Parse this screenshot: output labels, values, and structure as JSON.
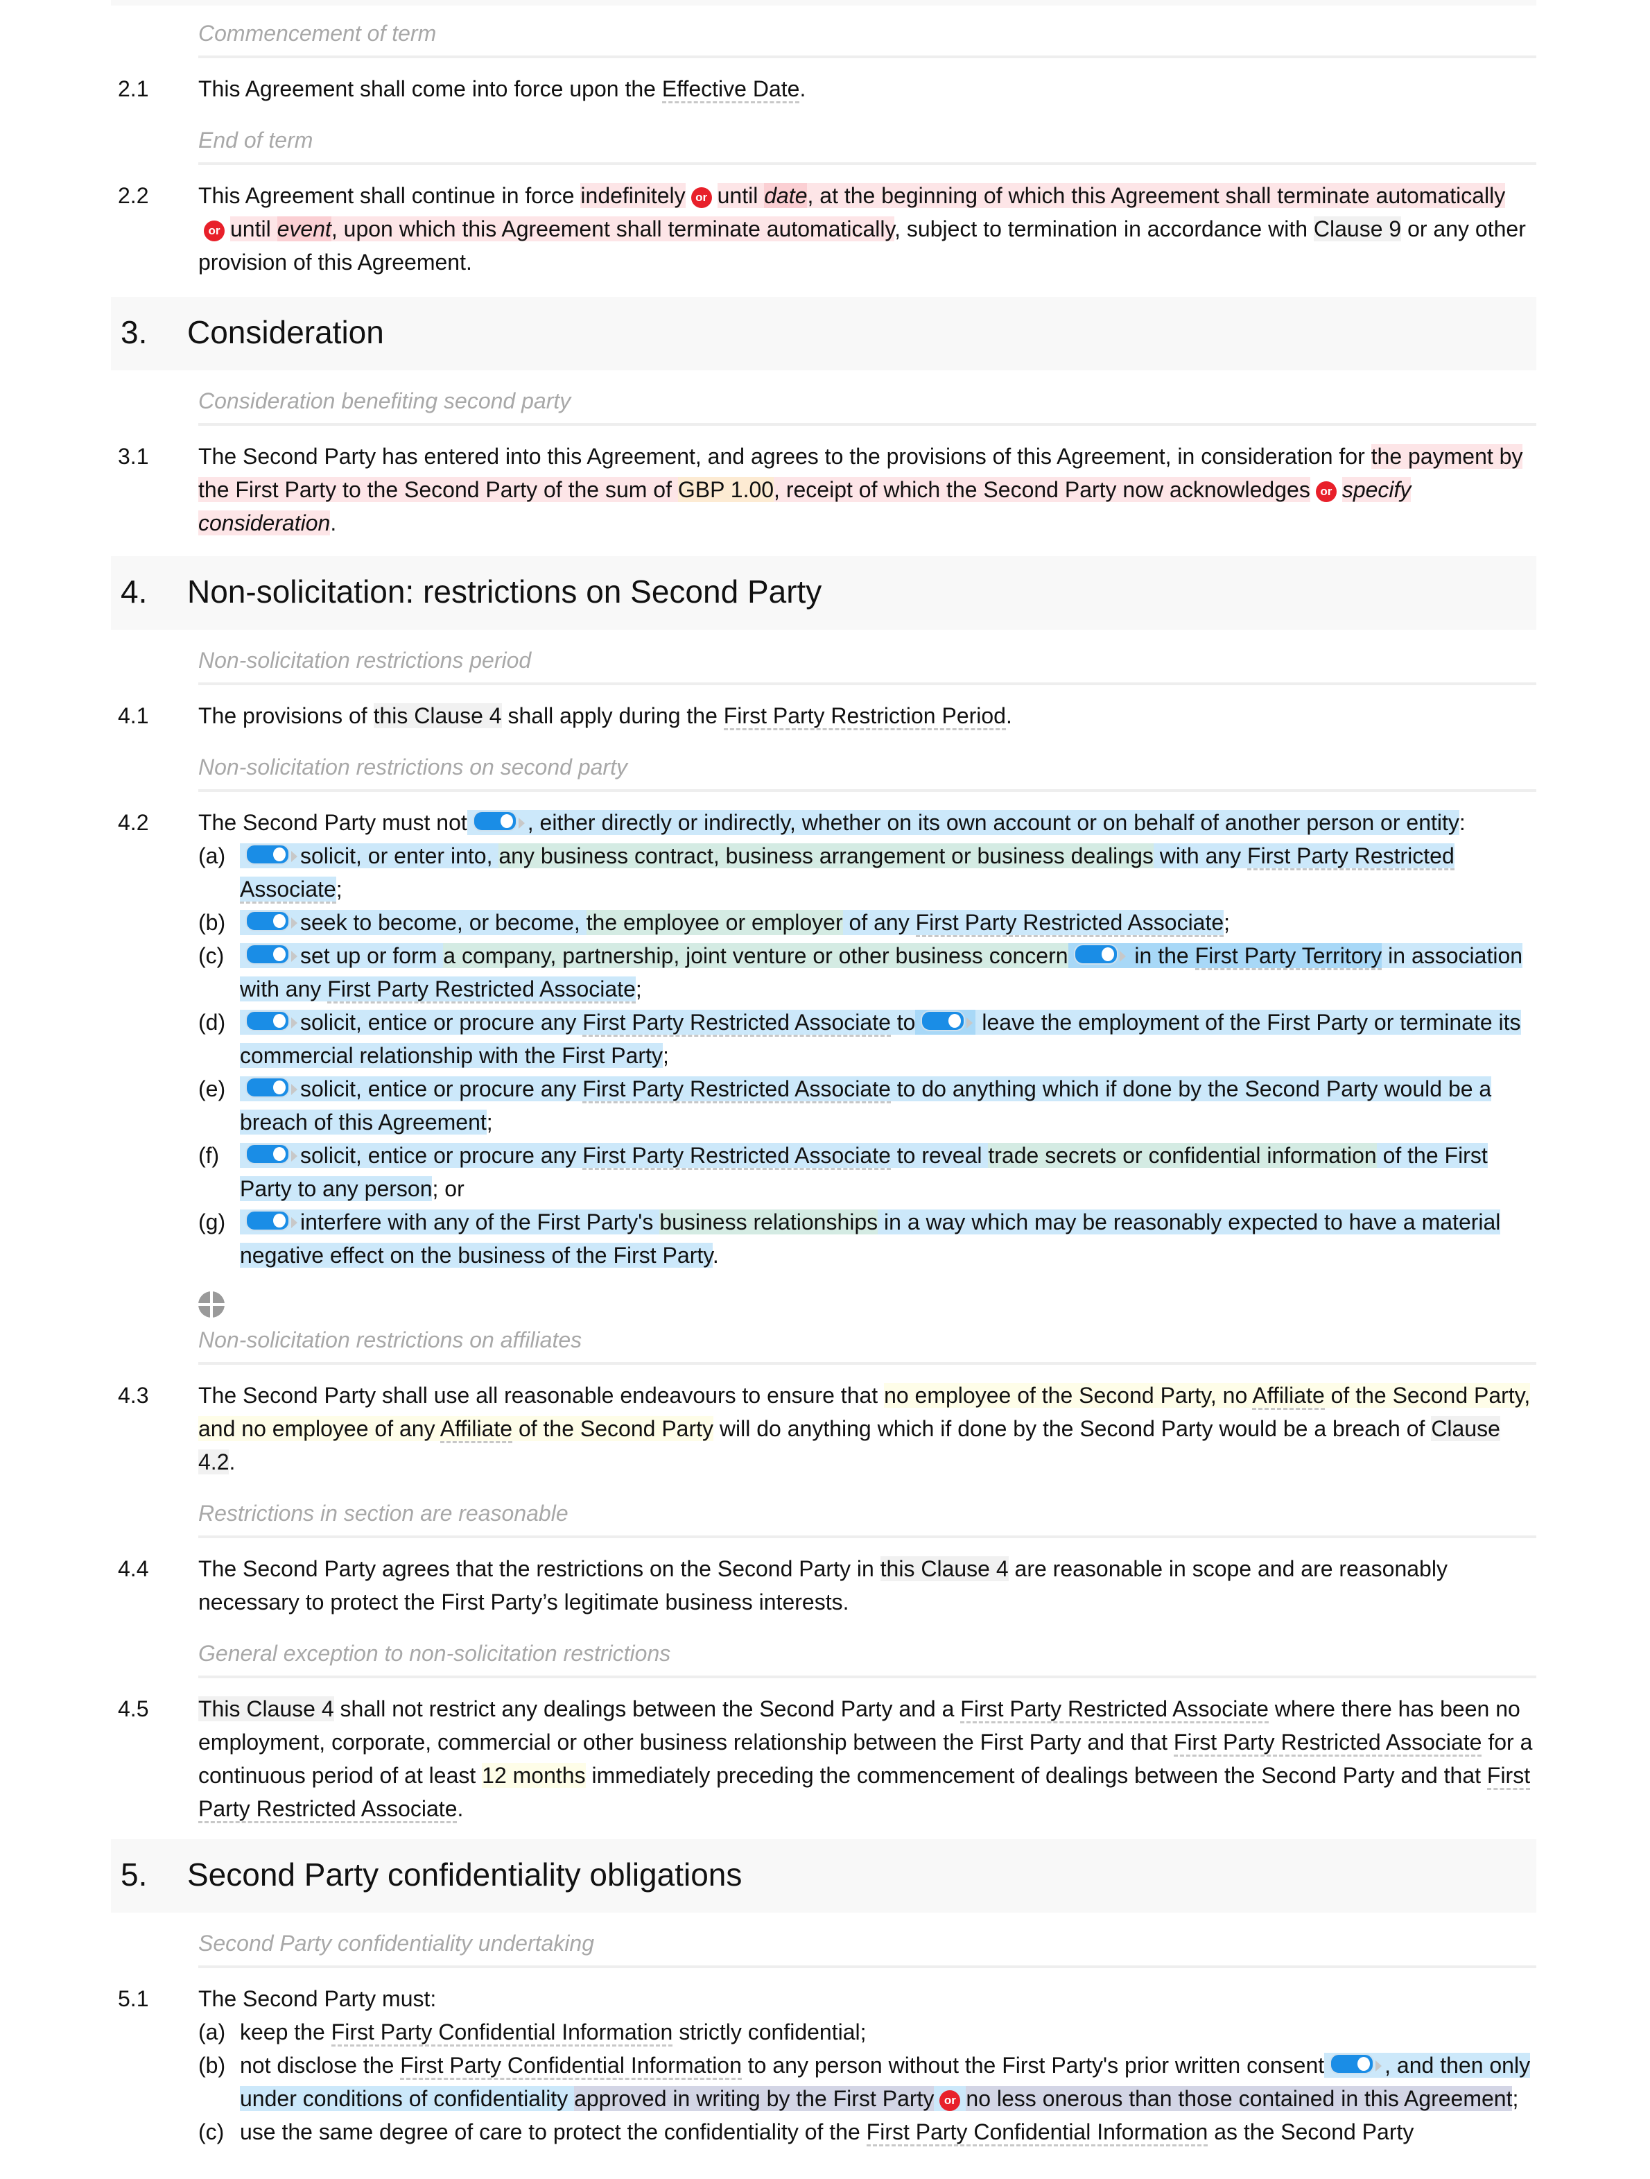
{
  "colors": {
    "or_badge": "#e8202a",
    "toggle": "#1a8de6",
    "subheading": "#a8a8a8"
  },
  "or_label": "or",
  "c2": {
    "sub1": "Commencement of term",
    "n1": "2.1",
    "t1a": "This Agreement shall come into force upon the ",
    "t1b": "Effective Date",
    "t1c": ".",
    "sub2": "End of term",
    "n2": "2.2",
    "t2a": "This Agreement shall continue in force ",
    "t2b": "indefinitely",
    "t2c": "until ",
    "t2d": "date",
    "t2e": ", at the beginning of which this Agreement shall terminate automatically",
    "t2f": "until ",
    "t2g": "event",
    "t2h": ", upon which this Agreement shall terminate automatically",
    "t2i": ", subject to termination in accordance with ",
    "t2j": "Clause 9",
    "t2k": " or any other provision of this Agreement."
  },
  "s3": {
    "num": "3.",
    "title": "Consideration",
    "sub1": "Consideration benefiting second party",
    "n1": "3.1",
    "a": "The Second Party has entered into this Agreement, and agrees to the provisions of this Agreement, in consideration for ",
    "b": "the payment by the First Party to the Second Party of the sum of ",
    "c": "GBP 1.00",
    "d": ", receipt of which the Second Party now acknowledges",
    "e": "specify consideration",
    "f": "."
  },
  "s4": {
    "num": "4.",
    "title": "Non-solicitation: restrictions on Second Party",
    "sub1": "Non-solicitation restrictions period",
    "n1": "4.1",
    "p1a": "The provisions of ",
    "p1b": "this Clause 4",
    "p1c": " shall apply during the ",
    "p1d": "First Party Restriction Period",
    "p1e": ".",
    "sub2": "Non-solicitation restrictions on second party",
    "n2": "4.2",
    "p2a": "The Second Party must not",
    "p2b": ", either directly or indirectly, whether on its own account or on behalf of another person or entity",
    "p2c": ":",
    "items": {
      "a": {
        "lbl": "(a)",
        "t1": "solicit, or enter into, ",
        "t2": "any business contract, business arrangement or business dealings",
        "t3": " with any ",
        "t4": "First Party Restricted Associate",
        "t5": ";"
      },
      "b": {
        "lbl": "(b)",
        "t1": "seek to become, or become, ",
        "t2": "the employee or employer",
        "t3": " of any ",
        "t4": "First Party Restricted Associate",
        "t5": ";"
      },
      "c": {
        "lbl": "(c)",
        "t1": "set up or form ",
        "t2": "a company, partnership, joint venture or other business concern",
        "t3": " in the ",
        "t4": "First Party Territory",
        "t5": " in association with any ",
        "t6": "First Party Restricted Associate",
        "t7": ";"
      },
      "d": {
        "lbl": "(d)",
        "t1": "solicit, entice or procure any ",
        "t2": "First Party Restricted Associate",
        "t3": " to",
        "t4": " leave the employment of the First Party or terminate its commercial relationship with the First Party",
        "t5": ";"
      },
      "e": {
        "lbl": "(e)",
        "t1": "solicit, entice or procure any ",
        "t2": "First Party Restricted Associate",
        "t3": " to do anything which if done by the Second Party would be a breach of this Agreement",
        "t4": ";"
      },
      "f": {
        "lbl": "(f)",
        "t1": "solicit, entice or procure any ",
        "t2": "First Party Restricted Associate",
        "t3": " to reveal ",
        "t4": "trade secrets or confidential information",
        "t5": " of the First Party to any person",
        "t6": "; or"
      },
      "g": {
        "lbl": "(g)",
        "t1": "interfere with any of the First Party's ",
        "t2": "business relationships",
        "t3": " in a way which may be reasonably expected to have a material negative effect on the business of the First Party",
        "t4": "."
      }
    },
    "sub3": "Non-solicitation restrictions on affiliates",
    "n3": "4.3",
    "p3a": "The Second Party shall use all reasonable endeavours to ensure that ",
    "p3b": "no employee of the Second Party, no ",
    "p3c": "Affiliate",
    "p3d": " of the Second Party, and no employee of any ",
    "p3e": "Affiliate",
    "p3f": " of the Second Party",
    "p3g": " will do anything which if done by the Second Party would be a breach of ",
    "p3h": "Clause 4.2",
    "p3i": ".",
    "sub4": "Restrictions in section are reasonable",
    "n4": "4.4",
    "p4a": "The Second Party agrees that the restrictions on the Second Party in ",
    "p4b": "this Clause 4",
    "p4c": " are reasonable in scope and are reasonably necessary to protect the First Party’s legitimate business interests.",
    "sub5": "General exception to non-solicitation restrictions",
    "n5": "4.5",
    "p5a": "This Clause 4",
    "p5b": " shall not restrict any dealings between the Second Party and a ",
    "p5c": "First Party Restricted Associate",
    "p5d": " where there has been no employment, corporate, commercial or other business relationship between the First Party and that ",
    "p5e": "First Party Restricted Associate",
    "p5f": " for a continuous period of at least ",
    "p5g": "12 months",
    "p5h": " immediately preceding the commencement of dealings between the Second Party and that ",
    "p5i": "First Party Restricted Associate",
    "p5j": "."
  },
  "s5": {
    "num": "5.",
    "title": "Second Party confidentiality obligations",
    "sub1": "Second Party confidentiality undertaking",
    "n1": "5.1",
    "intro": "The Second Party must:",
    "a": {
      "lbl": "(a)",
      "t1": "keep the ",
      "t2": "First Party Confidential Information",
      "t3": " strictly confidential;"
    },
    "b": {
      "lbl": "(b)",
      "t1": "not disclose the ",
      "t2": "First Party Confidential Information",
      "t3": " to any person without the First Party's prior written consent",
      "t4": ", and then only under conditions of confidentiality ",
      "t5": "approved in writing by the First Party",
      "t6": "no less onerous than those contained in this Agreement",
      "t7": ";"
    },
    "c": {
      "lbl": "(c)",
      "t1": "use the same degree of care to protect the confidentiality of the ",
      "t2": "First Party Confidential Information",
      "t3": " as the Second Party"
    }
  }
}
